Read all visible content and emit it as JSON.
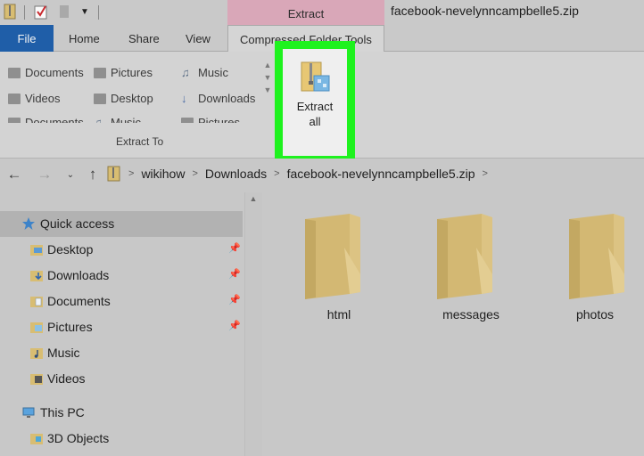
{
  "window": {
    "title": "facebook-nevelynncampbelle5.zip",
    "context_tab_group": "Extract"
  },
  "tabs": [
    {
      "label": "File",
      "name": "tab-file"
    },
    {
      "label": "Home",
      "name": "tab-home"
    },
    {
      "label": "Share",
      "name": "tab-share"
    },
    {
      "label": "View",
      "name": "tab-view"
    },
    {
      "label": "Compressed Folder Tools",
      "name": "tab-compressed-folder-tools"
    }
  ],
  "ribbon": {
    "gallery": [
      [
        "Documents",
        "Pictures",
        "Music"
      ],
      [
        "Videos",
        "Desktop",
        "Downloads"
      ],
      [
        "Documents",
        "Music",
        "Pictures"
      ]
    ],
    "group_label": "Extract To",
    "extract_all_label": "Extract\nall"
  },
  "address": {
    "crumbs": [
      "wikihow",
      "Downloads",
      "facebook-nevelynncampbelle5.zip"
    ]
  },
  "nav": {
    "quick_access": "Quick access",
    "items": [
      "Desktop",
      "Downloads",
      "Documents",
      "Pictures",
      "Music",
      "Videos"
    ],
    "this_pc": "This PC",
    "this_pc_items": [
      "3D Objects"
    ]
  },
  "content": {
    "folders": [
      "html",
      "messages",
      "photos"
    ]
  },
  "colors": {
    "file_tab": "#1f5ea8",
    "extract_context": "#d9a7b8",
    "highlight": "#1ef21e",
    "folder": "#dbc17e"
  }
}
